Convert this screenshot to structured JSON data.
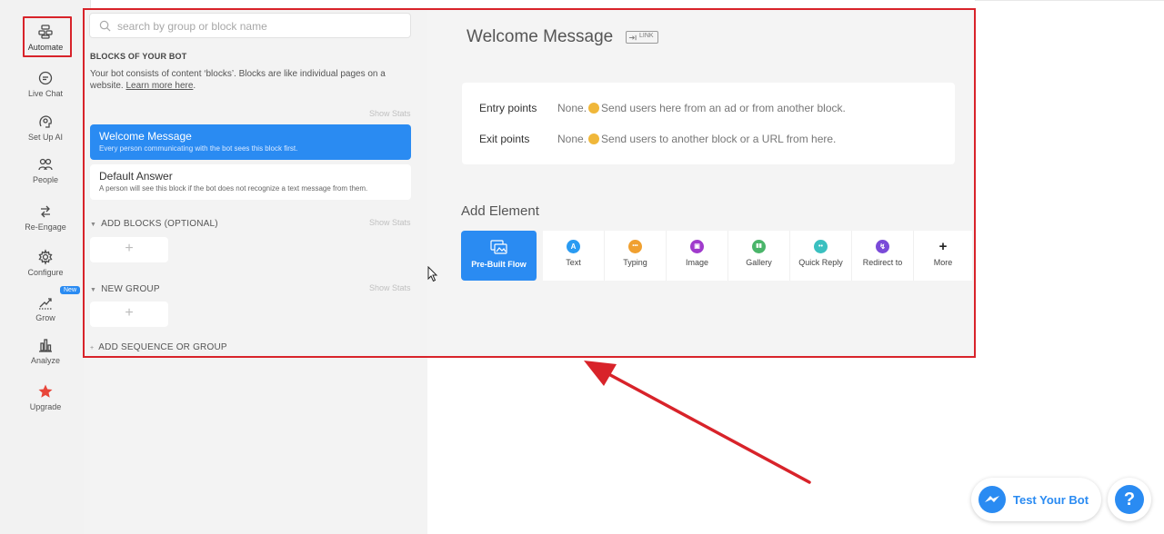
{
  "nav": {
    "items": [
      {
        "label": "Automate",
        "icon": "automate-icon"
      },
      {
        "label": "Live Chat",
        "icon": "chat-icon"
      },
      {
        "label": "Set Up AI",
        "icon": "ai-icon"
      },
      {
        "label": "People",
        "icon": "people-icon"
      },
      {
        "label": "Re-Engage",
        "icon": "reengage-icon"
      },
      {
        "label": "Configure",
        "icon": "gear-icon"
      },
      {
        "label": "Grow",
        "icon": "grow-icon"
      },
      {
        "label": "Analyze",
        "icon": "analyze-icon"
      },
      {
        "label": "Upgrade",
        "icon": "star-icon"
      }
    ],
    "new_badge": "New",
    "upgrade_color": "#e8463a"
  },
  "search": {
    "placeholder": "search by group or block name"
  },
  "blocks": {
    "title": "BLOCKS OF YOUR BOT",
    "desc_prefix": "Your bot consists of content ‘blocks’. Blocks are like individual pages on a website. ",
    "desc_link": "Learn more here",
    "desc_suffix": ".",
    "show_stats": "Show Stats",
    "items": [
      {
        "title": "Welcome Message",
        "subtitle": "Every person communicating with the bot sees this block first."
      },
      {
        "title": "Default Answer",
        "subtitle": "A person will see this block if the bot does not recognize a text message from them."
      }
    ],
    "groups": [
      {
        "label": "ADD BLOCKS (OPTIONAL)"
      },
      {
        "label": "NEW GROUP"
      },
      {
        "label": "ADD SEQUENCE OR GROUP"
      }
    ]
  },
  "main": {
    "title": "Welcome Message",
    "link_tag": "LINK",
    "entry_label": "Entry points",
    "entry_value_prefix": "None.",
    "entry_value_suffix": "Send users here from an ad or from another block.",
    "exit_label": "Exit points",
    "exit_value_prefix": "None.",
    "exit_value_suffix": "Send users to another block or a URL from here.",
    "add_element_title": "Add Element",
    "elements": [
      {
        "label": "Pre-Built Flow",
        "icon": "image-gallery-icon"
      },
      {
        "label": "Text",
        "icon": "text-icon",
        "glyph": "A",
        "color": "#2a9bf2"
      },
      {
        "label": "Typing",
        "icon": "typing-icon",
        "glyph": "•••",
        "color": "#f0a030"
      },
      {
        "label": "Image",
        "icon": "image-icon",
        "glyph": "▣",
        "color": "#a03acc"
      },
      {
        "label": "Gallery",
        "icon": "gallery-icon",
        "glyph": "▮▮",
        "color": "#4ab56a"
      },
      {
        "label": "Quick Reply",
        "icon": "quick-reply-icon",
        "glyph": "••",
        "color": "#3ac0c0"
      },
      {
        "label": "Redirect to",
        "icon": "redirect-icon",
        "glyph": "↯",
        "color": "#7a4ad8"
      },
      {
        "label": "More",
        "icon": "plus-icon",
        "glyph": "+",
        "color": "#ffffff"
      }
    ]
  },
  "floating": {
    "test_bot": "Test Your Bot",
    "help": "?"
  },
  "colors": {
    "accent": "#2a8bf2",
    "annotation": "#d8232a"
  }
}
